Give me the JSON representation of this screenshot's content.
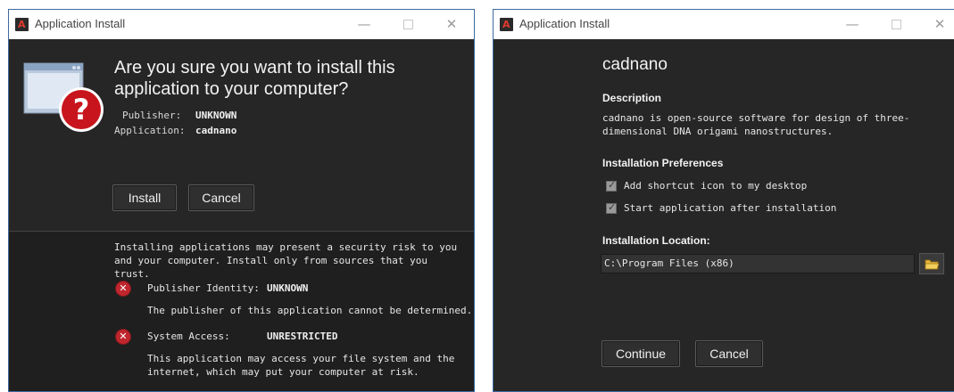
{
  "install_dialog": {
    "title": "Application Install",
    "headline": "Are you sure you want to install this application to your computer?",
    "publisher_label": "Publisher:",
    "publisher_value": "UNKNOWN",
    "application_label": "Application:",
    "application_value": "cadnano",
    "install_button": "Install",
    "cancel_button": "Cancel",
    "risk_warning": "Installing applications may present a security risk to you and your computer. Install only from sources that you trust.",
    "publisher_identity": {
      "label": "Publisher Identity:",
      "value": "UNKNOWN",
      "description": "The publisher of this application cannot be determined.",
      "icon": "error-icon"
    },
    "system_access": {
      "label": "System Access:",
      "value": "UNRESTRICTED",
      "description": "This application may access your file system and the internet, which may put your computer at risk.",
      "icon": "error-icon"
    }
  },
  "details_dialog": {
    "title": "Application Install",
    "app_name": "cadnano",
    "description_heading": "Description",
    "description": "cadnano is open-source software for design of three-dimensional DNA origami nanostructures.",
    "preferences_heading": "Installation Preferences",
    "preferences": [
      {
        "label": "Add shortcut icon to my desktop",
        "checked": true
      },
      {
        "label": "Start application after installation",
        "checked": true
      }
    ],
    "location_heading": "Installation Location:",
    "location_value": "C:\\Program Files (x86)",
    "continue_button": "Continue",
    "cancel_button": "Cancel"
  },
  "window_controls": {
    "minimize": "—",
    "close": "✕"
  },
  "colors": {
    "dialog_background": "#262626",
    "titlebar": "#ffffff",
    "error_red": "#c0262d",
    "text_light": "#f2f2f2"
  }
}
